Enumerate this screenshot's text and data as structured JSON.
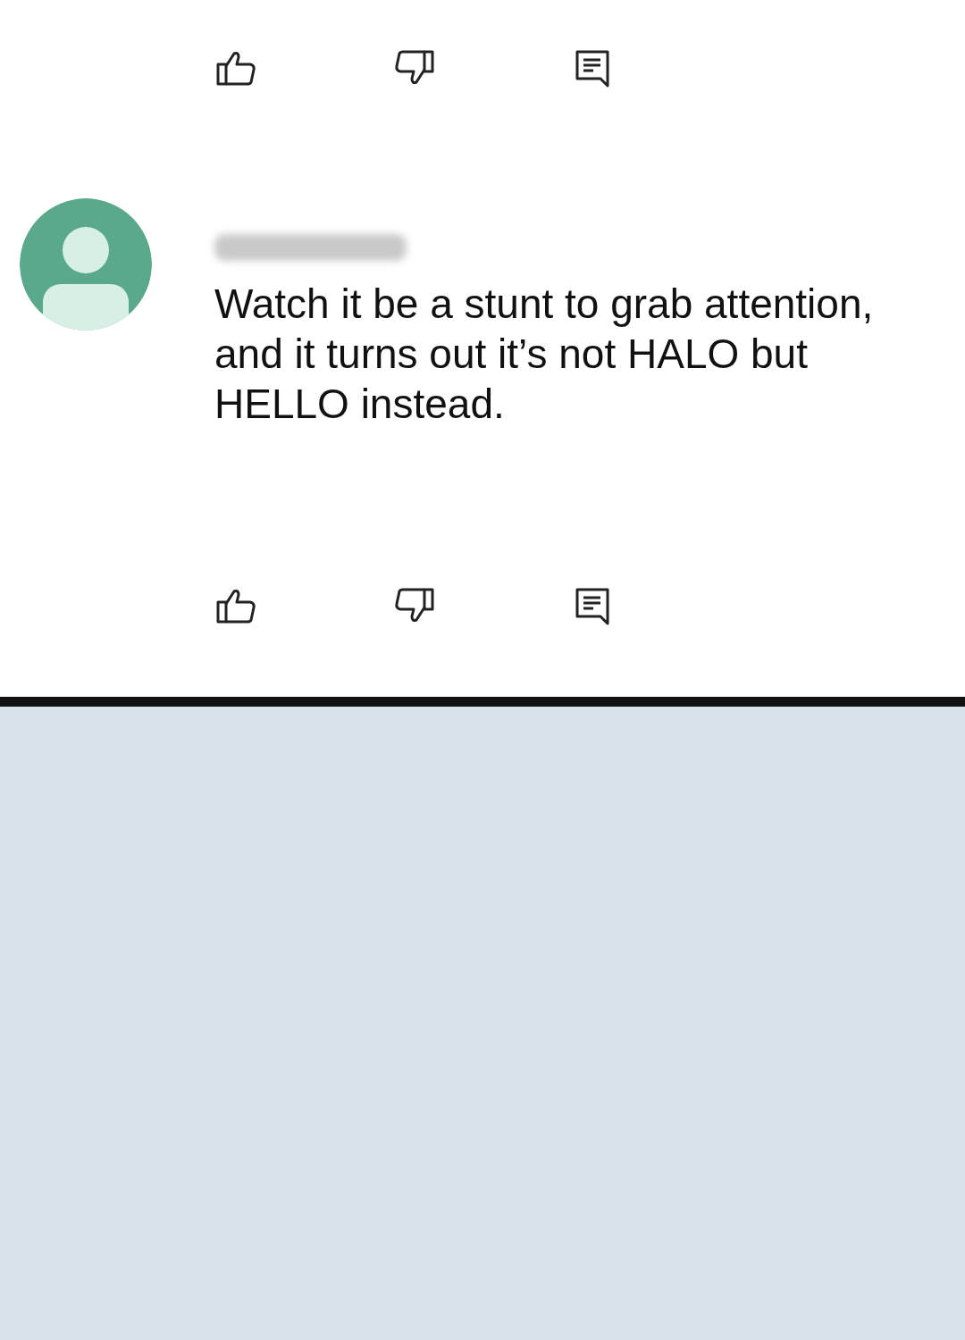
{
  "comment": {
    "text": "Watch it be a stunt to grab attention, and it turns out it’s not HALO but HELLO instead."
  }
}
